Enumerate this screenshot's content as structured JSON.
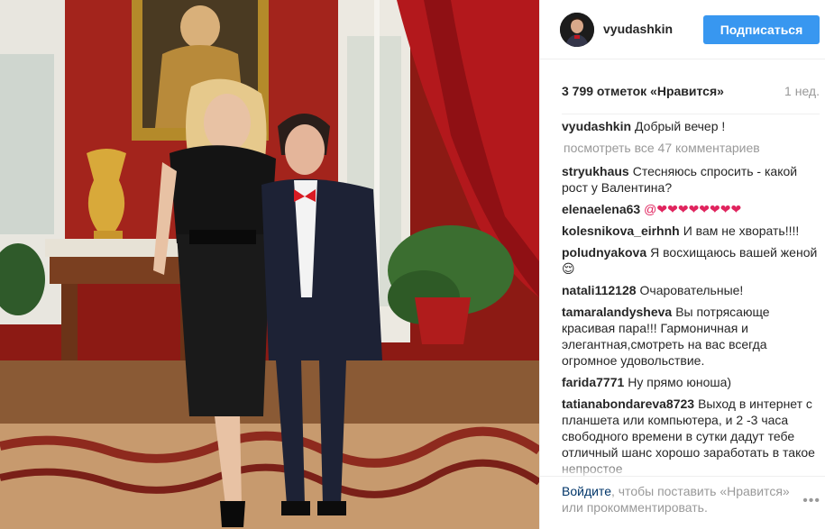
{
  "header": {
    "username": "vyudashkin",
    "follow_label": "Подписаться"
  },
  "stats": {
    "likes": "3 799 отметок «Нравится»",
    "time_ago": "1 нед."
  },
  "caption": {
    "author": "vyudashkin",
    "text": "Добрый вечер !"
  },
  "view_all_comments": "посмотреть все 47 комментариев",
  "comments": [
    {
      "author": "stryukhaus",
      "text": "Стесняюсь спросить - какой рост у Валентина?"
    },
    {
      "author": "elenaelena63",
      "text": "@❤❤❤❤❤❤❤❤"
    },
    {
      "author": "kolesnikova_eirhnh",
      "text": "И вам не хворать!!!!"
    },
    {
      "author": "poludnyakova",
      "text": "Я восхищаюсь вашей женой😌"
    },
    {
      "author": "natali112128",
      "text": "Очаровательные!"
    },
    {
      "author": "tamaralandysheva",
      "text": "Вы потрясающе красивая пара!!! Гармоничная и элегантная,смотреть на вас всегда огромное удовольствие."
    },
    {
      "author": "farida7771",
      "text": "Ну прямо юноша)"
    },
    {
      "author": "tatianabondareva8723",
      "text": "Выход в интернет с планшета или компьютера, и 2 -3 часа свободного времени в сутки дадут тебе отличный шанс хорошо заработать в такое непростое"
    }
  ],
  "footer": {
    "login_link": "Войдите",
    "text": ", чтобы поставить «Нравится» или прокомментировать.",
    "more_icon": "more-dots-icon"
  },
  "colors": {
    "accent": "#3897f0",
    "link": "#003569",
    "muted": "#999999",
    "text": "#262626"
  }
}
